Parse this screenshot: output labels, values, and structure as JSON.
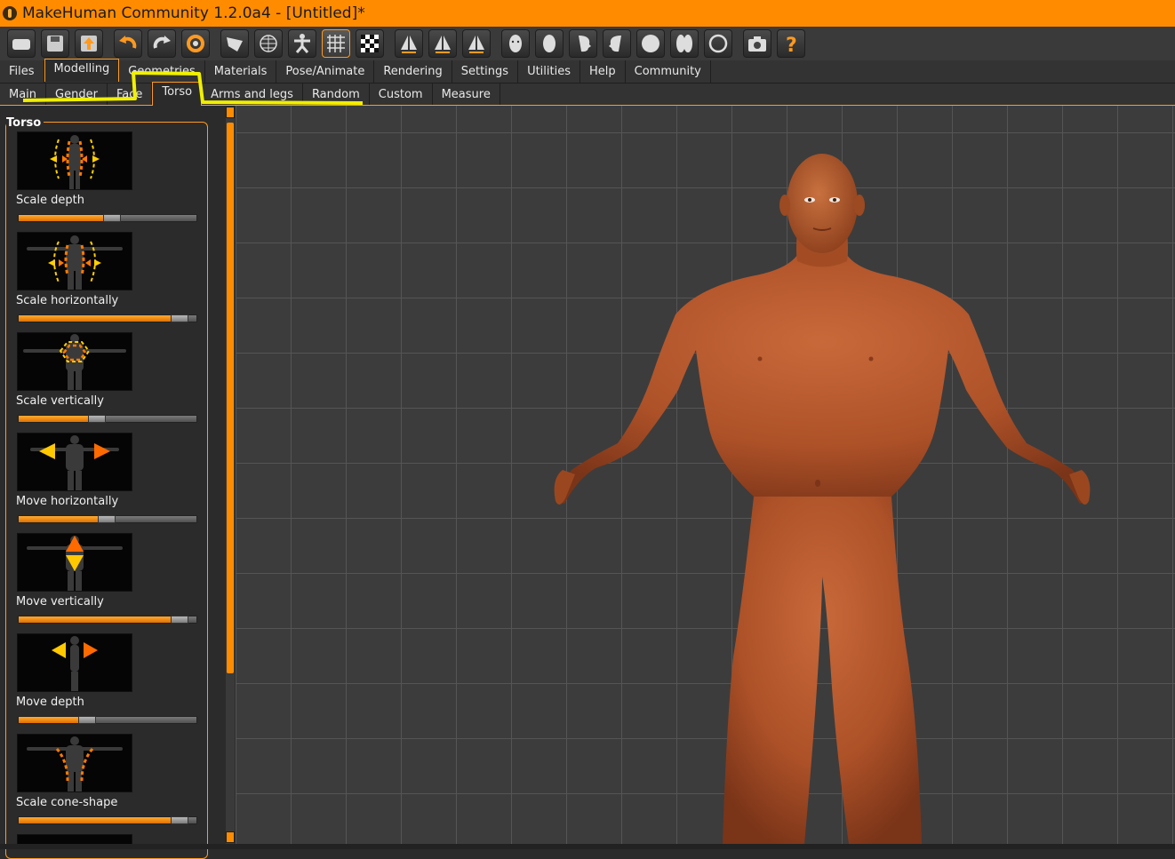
{
  "window": {
    "title": "MakeHuman Community 1.2.0a4 - [Untitled]*"
  },
  "toolbar": {
    "buttons": [
      "load-icon",
      "save-icon",
      "export-icon",
      "undo-icon",
      "redo-icon",
      "reset-icon",
      "smooth-icon",
      "wireframe-icon",
      "pose-icon",
      "grid-icon",
      "background-icon",
      "symmetry-right-icon",
      "symmetry-left-icon",
      "symmetry-icon",
      "front-view-icon",
      "back-view-icon",
      "left-view-icon",
      "right-view-icon",
      "top-view-icon",
      "bottom-view-icon",
      "reset-camera-icon",
      "screenshot-icon",
      "help-icon"
    ],
    "active": [
      "grid-icon"
    ],
    "accent": "#ff9a20"
  },
  "main_tabs": [
    {
      "label": "Files",
      "active": false
    },
    {
      "label": "Modelling",
      "active": true
    },
    {
      "label": "Geometries",
      "active": false
    },
    {
      "label": "Materials",
      "active": false
    },
    {
      "label": "Pose/Animate",
      "active": false
    },
    {
      "label": "Rendering",
      "active": false
    },
    {
      "label": "Settings",
      "active": false
    },
    {
      "label": "Utilities",
      "active": false
    },
    {
      "label": "Help",
      "active": false
    },
    {
      "label": "Community",
      "active": false
    }
  ],
  "sub_tabs": [
    {
      "label": "Main",
      "active": false
    },
    {
      "label": "Gender",
      "active": false
    },
    {
      "label": "Face",
      "active": false
    },
    {
      "label": "Torso",
      "active": true
    },
    {
      "label": "Arms and legs",
      "active": false
    },
    {
      "label": "Random",
      "active": false
    },
    {
      "label": "Custom",
      "active": false
    },
    {
      "label": "Measure",
      "active": false
    }
  ],
  "panel": {
    "title": "Torso",
    "sliders": [
      {
        "label": "Scale depth",
        "value": 0.52
      },
      {
        "label": "Scale horizontally",
        "value": 0.94
      },
      {
        "label": "Scale vertically",
        "value": 0.43
      },
      {
        "label": "Move horizontally",
        "value": 0.49
      },
      {
        "label": "Move vertically",
        "value": 0.94
      },
      {
        "label": "Move depth",
        "value": 0.37
      },
      {
        "label": "Scale cone-shape",
        "value": 0.94
      }
    ]
  },
  "colors": {
    "orange": "#ff8c00",
    "skin": "#b85a30",
    "highlight_yellow": "#f0f000"
  }
}
